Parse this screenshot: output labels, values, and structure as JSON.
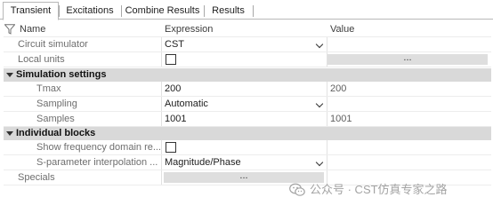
{
  "tabs": [
    {
      "label": "Transient"
    },
    {
      "label": "Excitations"
    },
    {
      "label": "Combine Results"
    },
    {
      "label": "Results"
    }
  ],
  "header": {
    "name": "Name",
    "expression": "Expression",
    "value": "Value"
  },
  "rows": {
    "circuit_simulator": {
      "name": "Circuit simulator",
      "expression": "CST"
    },
    "local_units": {
      "name": "Local units",
      "checked": false,
      "button": "..."
    },
    "group_sim": {
      "label": "Simulation settings"
    },
    "tmax": {
      "name": "Tmax",
      "expression": "200",
      "value": "200"
    },
    "sampling": {
      "name": "Sampling",
      "expression": "Automatic"
    },
    "samples": {
      "name": "Samples",
      "expression": "1001",
      "value": "1001"
    },
    "group_blocks": {
      "label": "Individual blocks"
    },
    "show_freq": {
      "name": "Show frequency domain re...",
      "checked": false
    },
    "sparam": {
      "name": "S-parameter interpolation ...",
      "expression": "Magnitude/Phase"
    },
    "specials": {
      "name": "Specials",
      "button": "..."
    }
  },
  "watermark": {
    "text": "公众号 · CST仿真专家之路"
  },
  "icons": [
    "filter-icon",
    "collapse-icon",
    "dropdown-chevron-icon",
    "checkbox",
    "wechat-icon"
  ]
}
